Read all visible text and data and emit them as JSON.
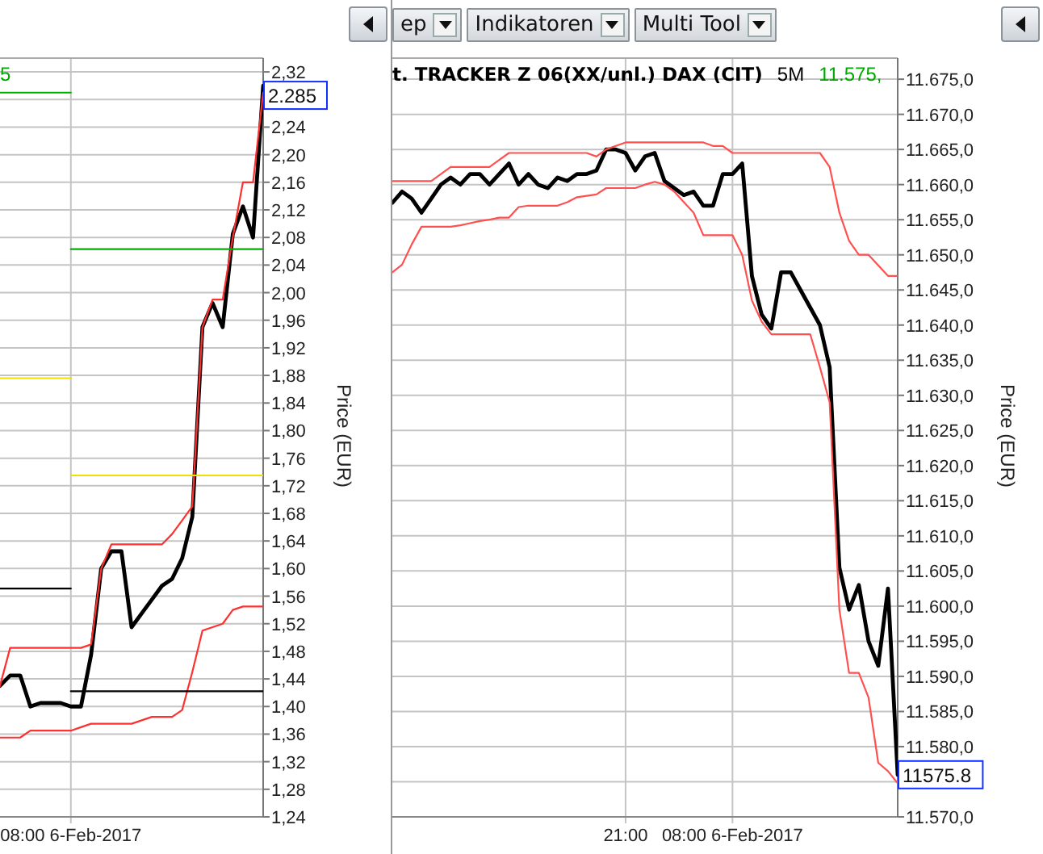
{
  "left_panel": {
    "toolbar": [
      {
        "kind": "arrow"
      }
    ],
    "chart": {
      "title_items": [
        {
          "kind": "price",
          "text": "5",
          "color": "#00a800"
        }
      ],
      "last_price": "2.285",
      "ylabel": "Price (EUR)",
      "chart_data": {
        "type": "line",
        "categories": [
          null,
          null,
          null,
          null,
          null,
          null,
          null,
          "08:00 6-Feb-2017",
          null,
          null,
          null,
          null,
          null,
          null,
          null,
          null,
          null,
          null,
          null,
          null,
          null,
          null,
          null,
          null,
          null,
          null,
          null
        ],
        "ylim": [
          1.24,
          2.34
        ],
        "grid": true,
        "yticks": [
          {
            "value": 2.32,
            "label": "2,32"
          },
          {
            "value": 2.24,
            "label": "2,24"
          },
          {
            "value": 2.2,
            "label": "2,20"
          },
          {
            "value": 2.16,
            "label": "2,16"
          },
          {
            "value": 2.12,
            "label": "2,12"
          },
          {
            "value": 2.08,
            "label": "2,08"
          },
          {
            "value": 2.04,
            "label": "2,04"
          },
          {
            "value": 2.0,
            "label": "2,00"
          },
          {
            "value": 1.96,
            "label": "1,96"
          },
          {
            "value": 1.92,
            "label": "1,92"
          },
          {
            "value": 1.88,
            "label": "1,88"
          },
          {
            "value": 1.84,
            "label": "1,84"
          },
          {
            "value": 1.8,
            "label": "1,80"
          },
          {
            "value": 1.76,
            "label": "1,76"
          },
          {
            "value": 1.72,
            "label": "1,72"
          },
          {
            "value": 1.68,
            "label": "1,68"
          },
          {
            "value": 1.64,
            "label": "1,64"
          },
          {
            "value": 1.6,
            "label": "1,60"
          },
          {
            "value": 1.56,
            "label": "1,56"
          },
          {
            "value": 1.52,
            "label": "1,52"
          },
          {
            "value": 1.48,
            "label": "1,48"
          },
          {
            "value": 1.44,
            "label": "1,44"
          },
          {
            "value": 1.4,
            "label": "1,40"
          },
          {
            "value": 1.36,
            "label": "1,36"
          },
          {
            "value": 1.32,
            "label": "1,32"
          },
          {
            "value": 1.28,
            "label": "1,28"
          },
          {
            "value": 1.24,
            "label": "1,24"
          }
        ],
        "series": [
          {
            "color": "#000000",
            "values": [
              1.43,
              1.445,
              1.445,
              1.4,
              1.405,
              1.405,
              1.405,
              1.4,
              1.4,
              1.475,
              1.6,
              1.625,
              1.625,
              1.515,
              1.535,
              1.555,
              1.575,
              1.585,
              1.615,
              1.675,
              1.95,
              1.985,
              1.95,
              2.085,
              2.125,
              2.08,
              2.3
            ]
          },
          {
            "color": "#ff3030",
            "values": [
              1.43,
              1.485,
              1.485,
              1.485,
              1.485,
              1.485,
              1.485,
              1.485,
              1.485,
              1.49,
              1.6,
              1.635,
              1.635,
              1.635,
              1.635,
              1.635,
              1.635,
              1.65,
              1.67,
              1.69,
              1.95,
              1.99,
              1.99,
              2.08,
              2.16,
              2.16,
              2.29
            ]
          },
          {
            "color": "#ff3030",
            "values": [
              1.355,
              1.355,
              1.355,
              1.365,
              1.365,
              1.365,
              1.365,
              1.365,
              1.37,
              1.375,
              1.375,
              1.375,
              1.375,
              1.375,
              1.38,
              1.385,
              1.385,
              1.385,
              1.395,
              1.45,
              1.51,
              1.515,
              1.52,
              1.54,
              1.545,
              1.545,
              1.545
            ]
          },
          {
            "color": "#00b000",
            "values": [
              2.29,
              2.29,
              2.29,
              2.29,
              2.29,
              2.29,
              2.29,
              2.29,
              null,
              null,
              null,
              null,
              null,
              null,
              null,
              null,
              null,
              null,
              null,
              null,
              null,
              null,
              null,
              null,
              null,
              null,
              null
            ]
          },
          {
            "color": "#00b000",
            "values": [
              null,
              null,
              null,
              null,
              null,
              null,
              null,
              2.063,
              2.063,
              2.063,
              2.063,
              2.063,
              2.063,
              2.063,
              2.063,
              2.063,
              2.063,
              2.063,
              2.063,
              2.063,
              2.063,
              2.063,
              2.063,
              2.063,
              2.063,
              2.063,
              2.063
            ]
          },
          {
            "color": "#f0e000",
            "values": [
              1.876,
              1.876,
              1.876,
              1.876,
              1.876,
              1.876,
              1.876,
              1.876,
              null,
              null,
              null,
              null,
              null,
              null,
              null,
              null,
              null,
              null,
              null,
              null,
              null,
              null,
              null,
              null,
              null,
              null,
              null
            ]
          },
          {
            "color": "#f0e000",
            "values": [
              null,
              null,
              null,
              null,
              null,
              null,
              null,
              1.735,
              1.735,
              1.735,
              1.735,
              1.735,
              1.735,
              1.735,
              1.735,
              1.735,
              1.735,
              1.735,
              1.735,
              1.735,
              1.735,
              1.735,
              1.735,
              1.735,
              1.735,
              1.735,
              1.735
            ]
          },
          {
            "color": "#000000",
            "values": [
              1.571,
              1.571,
              1.571,
              1.571,
              1.571,
              1.571,
              1.571,
              1.571,
              null,
              null,
              null,
              null,
              null,
              null,
              null,
              null,
              null,
              null,
              null,
              null,
              null,
              null,
              null,
              null,
              null,
              null,
              null
            ]
          },
          {
            "color": "#000000",
            "values": [
              null,
              null,
              null,
              null,
              null,
              null,
              null,
              1.422,
              1.422,
              1.422,
              1.422,
              1.422,
              1.422,
              1.422,
              1.422,
              1.422,
              1.422,
              1.422,
              1.422,
              1.422,
              1.422,
              1.422,
              1.422,
              1.422,
              1.422,
              1.422,
              1.422
            ]
          }
        ]
      }
    }
  },
  "right_panel": {
    "toolbar": [
      {
        "kind": "dropdown",
        "label": "ep"
      },
      {
        "kind": "dropdown",
        "label": "Indikatoren"
      },
      {
        "kind": "dropdown",
        "label": "Multi Tool"
      },
      {
        "kind": "arrow"
      }
    ],
    "chart": {
      "title_items": [
        {
          "kind": "title",
          "text": "t. TRACKER Z 06(XX/unl.) DAX (CIT)",
          "color": "#000000"
        },
        {
          "kind": "interval",
          "text": "5M",
          "color": "#000000"
        },
        {
          "kind": "price",
          "text": "11.575,",
          "color": "#00a800"
        }
      ],
      "last_price": "11575.8",
      "ylabel": "Price (EUR)",
      "chart_data": {
        "type": "line",
        "categories": [
          null,
          null,
          null,
          null,
          null,
          null,
          null,
          null,
          null,
          null,
          null,
          null,
          null,
          null,
          null,
          null,
          null,
          null,
          null,
          null,
          null,
          null,
          null,
          null,
          "21:00",
          null,
          null,
          null,
          null,
          null,
          null,
          null,
          null,
          null,
          null,
          "08:00 6-Feb-2017",
          null,
          null,
          null,
          null,
          null,
          null,
          null,
          null,
          null,
          null,
          null,
          null,
          null,
          null,
          null,
          null,
          null
        ],
        "ylim": [
          11570,
          11678
        ],
        "grid": true,
        "yticks": [
          {
            "value": 11675,
            "label": "11.675,0"
          },
          {
            "value": 11670,
            "label": "11.670,0"
          },
          {
            "value": 11665,
            "label": "11.665,0"
          },
          {
            "value": 11660,
            "label": "11.660,0"
          },
          {
            "value": 11655,
            "label": "11.655,0"
          },
          {
            "value": 11650,
            "label": "11.650,0"
          },
          {
            "value": 11645,
            "label": "11.645,0"
          },
          {
            "value": 11640,
            "label": "11.640,0"
          },
          {
            "value": 11635,
            "label": "11.635,0"
          },
          {
            "value": 11630,
            "label": "11.630,0"
          },
          {
            "value": 11625,
            "label": "11.625,0"
          },
          {
            "value": 11620,
            "label": "11.620,0"
          },
          {
            "value": 11615,
            "label": "11.615,0"
          },
          {
            "value": 11610,
            "label": "11.610,0"
          },
          {
            "value": 11605,
            "label": "11.605,0"
          },
          {
            "value": 11600,
            "label": "11.600,0"
          },
          {
            "value": 11595,
            "label": "11.595,0"
          },
          {
            "value": 11590,
            "label": "11.590,0"
          },
          {
            "value": 11585,
            "label": "11.585,0"
          },
          {
            "value": 11580,
            "label": "11.580,0"
          },
          {
            "value": 11570,
            "label": "11.570,0"
          }
        ],
        "series": [
          {
            "color": "#000000",
            "values": [
              11657.4,
              11659,
              11658,
              11656,
              11658,
              11660,
              11661,
              11660,
              11661.5,
              11661.5,
              11660,
              11661.5,
              11663,
              11660,
              11661.5,
              11660,
              11659.5,
              11661,
              11660.5,
              11661.5,
              11661.5,
              11662,
              11665,
              11665,
              11664.5,
              11662,
              11664,
              11664.5,
              11660.5,
              11659.5,
              11658.5,
              11659,
              11657,
              11657,
              11661.5,
              11661.5,
              11663,
              11647,
              11641.5,
              11639.5,
              11647.5,
              11647.5,
              11645,
              11642.5,
              11640,
              11634,
              11605.5,
              11599.5,
              11603,
              11595,
              11591.5,
              11602.5,
              11576
            ]
          },
          {
            "color": "#ff5050",
            "values": [
              11660.5,
              11660.5,
              11660.5,
              11660.5,
              11660.5,
              11661.5,
              11662.5,
              11662.5,
              11662.5,
              11662.5,
              11662.5,
              11663.5,
              11664.5,
              11664.5,
              11664.5,
              11664.5,
              11664.5,
              11664.5,
              11664.5,
              11664.5,
              11664.5,
              11664,
              11665,
              11665.5,
              11666,
              11666,
              11666,
              11666,
              11666,
              11666,
              11666,
              11666,
              11666,
              11665.5,
              11665.5,
              11664.5,
              11664.5,
              11664.5,
              11664.5,
              11664.5,
              11664.5,
              11664.5,
              11664.5,
              11664.5,
              11664.5,
              11662.5,
              11656,
              11652,
              11650,
              11650,
              11648.5,
              11647,
              11647
            ]
          },
          {
            "color": "#ff5050",
            "values": [
              11647.5,
              11648.6,
              11651.5,
              11654,
              11654,
              11654,
              11654,
              11654.2,
              11654.5,
              11654.8,
              11655,
              11655.3,
              11655.3,
              11656.8,
              11657,
              11657,
              11657,
              11657,
              11657.5,
              11658.2,
              11658.4,
              11658.6,
              11659.5,
              11659.5,
              11659.5,
              11659.5,
              11660,
              11660.4,
              11660,
              11659,
              11657.5,
              11656,
              11652.8,
              11652.8,
              11652.8,
              11652.8,
              11650,
              11643.5,
              11640.5,
              11638.7,
              11638.7,
              11638.7,
              11638.7,
              11638.7,
              11634,
              11629,
              11599.5,
              11590.5,
              11590.5,
              11587,
              11577.7,
              11576.5,
              11574.8
            ]
          }
        ]
      }
    }
  }
}
